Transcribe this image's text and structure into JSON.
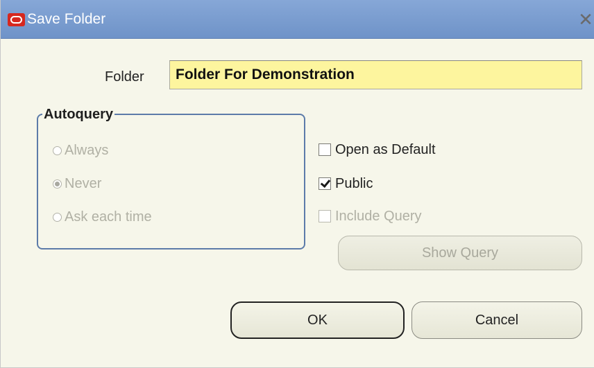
{
  "window": {
    "title": "Save Folder",
    "logo_icon": "oracle-logo-icon",
    "close_glyph": "✕"
  },
  "folder": {
    "label": "Folder",
    "value": "Folder For Demonstration"
  },
  "autoquery": {
    "legend": "Autoquery",
    "options": [
      {
        "label": "Always",
        "checked": false,
        "enabled": false
      },
      {
        "label": "Never",
        "checked": true,
        "enabled": false
      },
      {
        "label": "Ask each time",
        "checked": false,
        "enabled": false
      }
    ]
  },
  "options": {
    "open_as_default": {
      "label": "Open as Default",
      "checked": false,
      "enabled": true
    },
    "public": {
      "label": "Public",
      "checked": true,
      "enabled": true
    },
    "include_query": {
      "label": "Include Query",
      "checked": false,
      "enabled": false
    }
  },
  "buttons": {
    "show_query": "Show Query",
    "ok": "OK",
    "cancel": "Cancel"
  },
  "colors": {
    "title_bar": "#7b9dd0",
    "dialog_background": "#f6f6ea",
    "input_background": "#fdf59e",
    "group_border": "#5c7ba9",
    "brand_red": "#d6281f"
  }
}
